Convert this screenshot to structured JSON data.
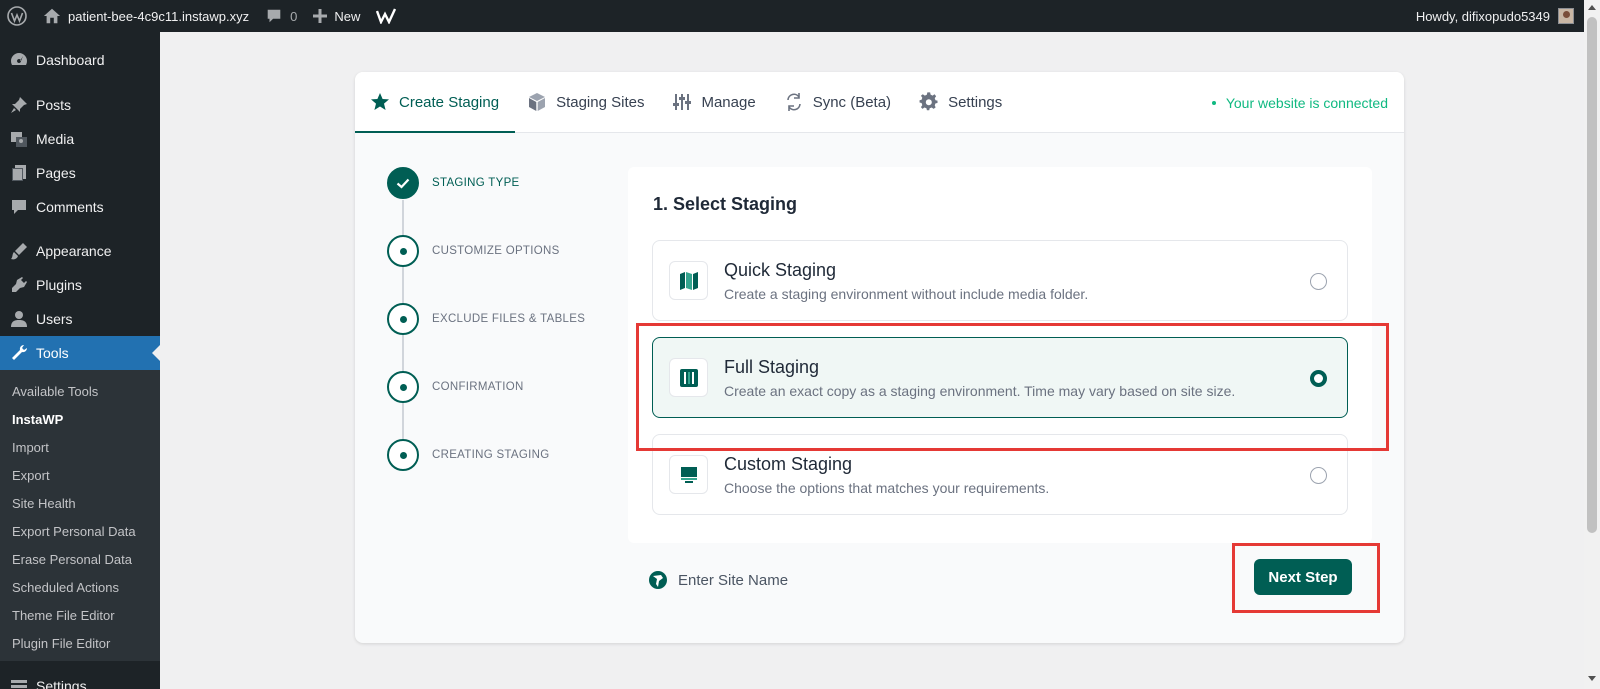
{
  "adminbar": {
    "site_name": "patient-bee-4c9c11.instawp.xyz",
    "comments_count": "0",
    "new_label": "New",
    "greeting": "Howdy, difixopudo5349"
  },
  "sidebar": {
    "items": [
      {
        "label": "Dashboard",
        "icon": "dashboard-icon"
      },
      {
        "label": "Posts",
        "icon": "pin-icon"
      },
      {
        "label": "Media",
        "icon": "media-icon"
      },
      {
        "label": "Pages",
        "icon": "pages-icon"
      },
      {
        "label": "Comments",
        "icon": "comment-icon"
      },
      {
        "label": "Appearance",
        "icon": "brush-icon"
      },
      {
        "label": "Plugins",
        "icon": "plugin-icon"
      },
      {
        "label": "Users",
        "icon": "user-icon"
      },
      {
        "label": "Tools",
        "icon": "wrench-icon"
      },
      {
        "label": "Settings",
        "icon": "settings-icon"
      }
    ],
    "submenu": [
      "Available Tools",
      "InstaWP",
      "Import",
      "Export",
      "Site Health",
      "Export Personal Data",
      "Erase Personal Data",
      "Scheduled Actions",
      "Theme File Editor",
      "Plugin File Editor"
    ]
  },
  "tabs": [
    {
      "label": "Create Staging",
      "icon": "star-icon"
    },
    {
      "label": "Staging Sites",
      "icon": "cube-icon"
    },
    {
      "label": "Manage",
      "icon": "sliders-icon"
    },
    {
      "label": "Sync (Beta)",
      "icon": "sync-icon"
    },
    {
      "label": "Settings",
      "icon": "gear-icon"
    }
  ],
  "connection_status": "Your website is connected",
  "steps": [
    "STAGING TYPE",
    "CUSTOMIZE OPTIONS",
    "EXCLUDE FILES & TABLES",
    "CONFIRMATION",
    "CREATING STAGING"
  ],
  "panel": {
    "heading": "1. Select Staging",
    "options": [
      {
        "title": "Quick Staging",
        "desc": "Create a staging environment without include media folder.",
        "selected": false
      },
      {
        "title": "Full Staging",
        "desc": "Create an exact copy as a staging environment. Time may vary based on site size.",
        "selected": true
      },
      {
        "title": "Custom Staging",
        "desc": "Choose the options that matches your requirements.",
        "selected": false
      }
    ]
  },
  "site_name_label": "Enter Site Name",
  "next_button": "Next Step",
  "colors": {
    "brand": "#005e54",
    "connected": "#10b981",
    "highlight": "#e53935",
    "admin_bar": "#1d2327",
    "current_menu": "#2271b1"
  }
}
